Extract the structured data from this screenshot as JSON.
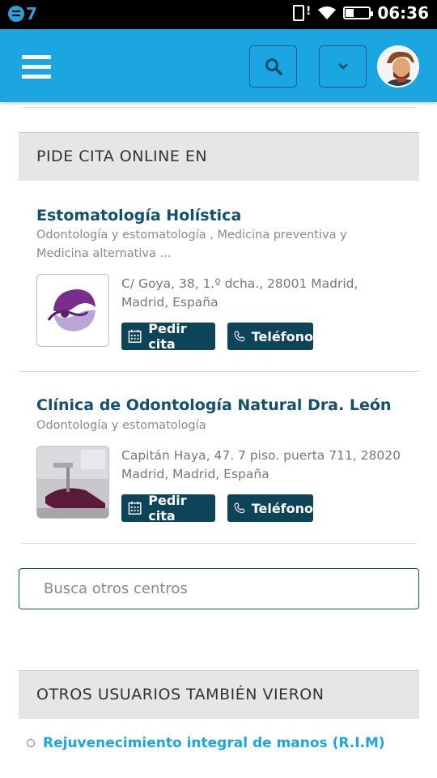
{
  "status_bar": {
    "notification_count": "7",
    "time": "06:36",
    "icons": [
      "notification-icon",
      "sim-alert-icon",
      "wifi-icon",
      "battery-icon"
    ]
  },
  "app_bar": {
    "icons": [
      "hamburger-menu-icon",
      "search-icon",
      "chevron-down-icon",
      "avatar"
    ],
    "colors": {
      "background": "#1ba6e2",
      "button_border": "#0b5a84"
    }
  },
  "section_book": {
    "title": "PIDE CITA ONLINE EN"
  },
  "clinics": [
    {
      "name": "Estomatología Holística",
      "category": "Odontología y estomatología , Medicina preventiva y Medicina alternativa ...",
      "address": "C/ Goya, 38, 1.º dcha., 28001 Madrid, Madrid, España",
      "book_label": "Pedir cita",
      "phone_label": "Teléfono"
    },
    {
      "name": "Clínica de Odontología Natural Dra. León",
      "category": "Odontología y estomatología",
      "address": "Capitán Haya, 47. 7 piso. puerta 711, 28020 Madrid, Madrid, España",
      "book_label": "Pedir cita",
      "phone_label": "Teléfono"
    }
  ],
  "search_other": {
    "placeholder": "Busca otros centros"
  },
  "section_related": {
    "title": "OTROS USUARIOS TAMBIÉN VIERON",
    "items": [
      "Rejuvenecimiento integral de manos (R.I.M)"
    ]
  },
  "colors": {
    "accent": "#1ba6e2",
    "button_dark": "#0d4459",
    "title": "#12506b"
  }
}
